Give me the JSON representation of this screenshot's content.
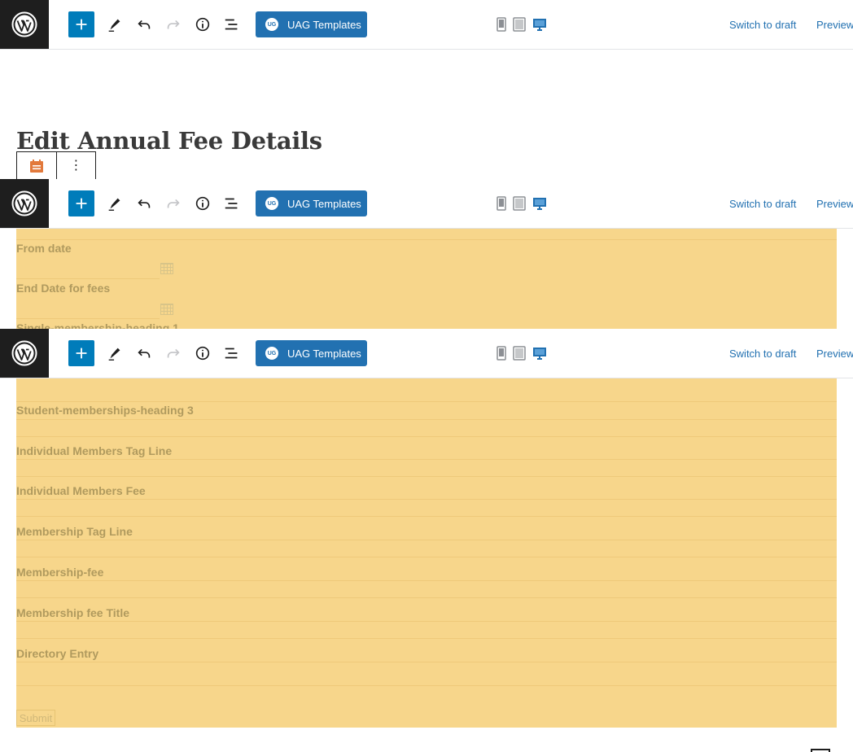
{
  "toolbar": {
    "uag_label": "UAG Templates",
    "uag_logo_text": "UG",
    "switch_draft": "Switch to draft",
    "preview": "Preview",
    "icons": [
      "wordpress-icon",
      "plus-icon",
      "pencil-icon",
      "undo-icon",
      "redo-icon",
      "info-icon",
      "list-view-icon",
      "mobile-icon",
      "tablet-icon",
      "desktop-icon"
    ],
    "accent_color": "#007cba"
  },
  "page": {
    "title": "Edit Annual Fee Details"
  },
  "block_toolbar": {
    "icons": [
      "calendar-icon",
      "more-options-icon"
    ],
    "more_glyph": "⋮"
  },
  "form": {
    "background_color": "#f7d68b",
    "top_labels": [
      "From date",
      "End Date for fees",
      "Single-membership-heading 1"
    ],
    "labels": [
      "Student-memberships-heading 3",
      "Individual Members Tag Line",
      "Individual Members Fee",
      "Membership Tag Line",
      "Membership-fee",
      "Membership fee Title",
      "Directory Entry"
    ],
    "submit_label": "Submit"
  }
}
